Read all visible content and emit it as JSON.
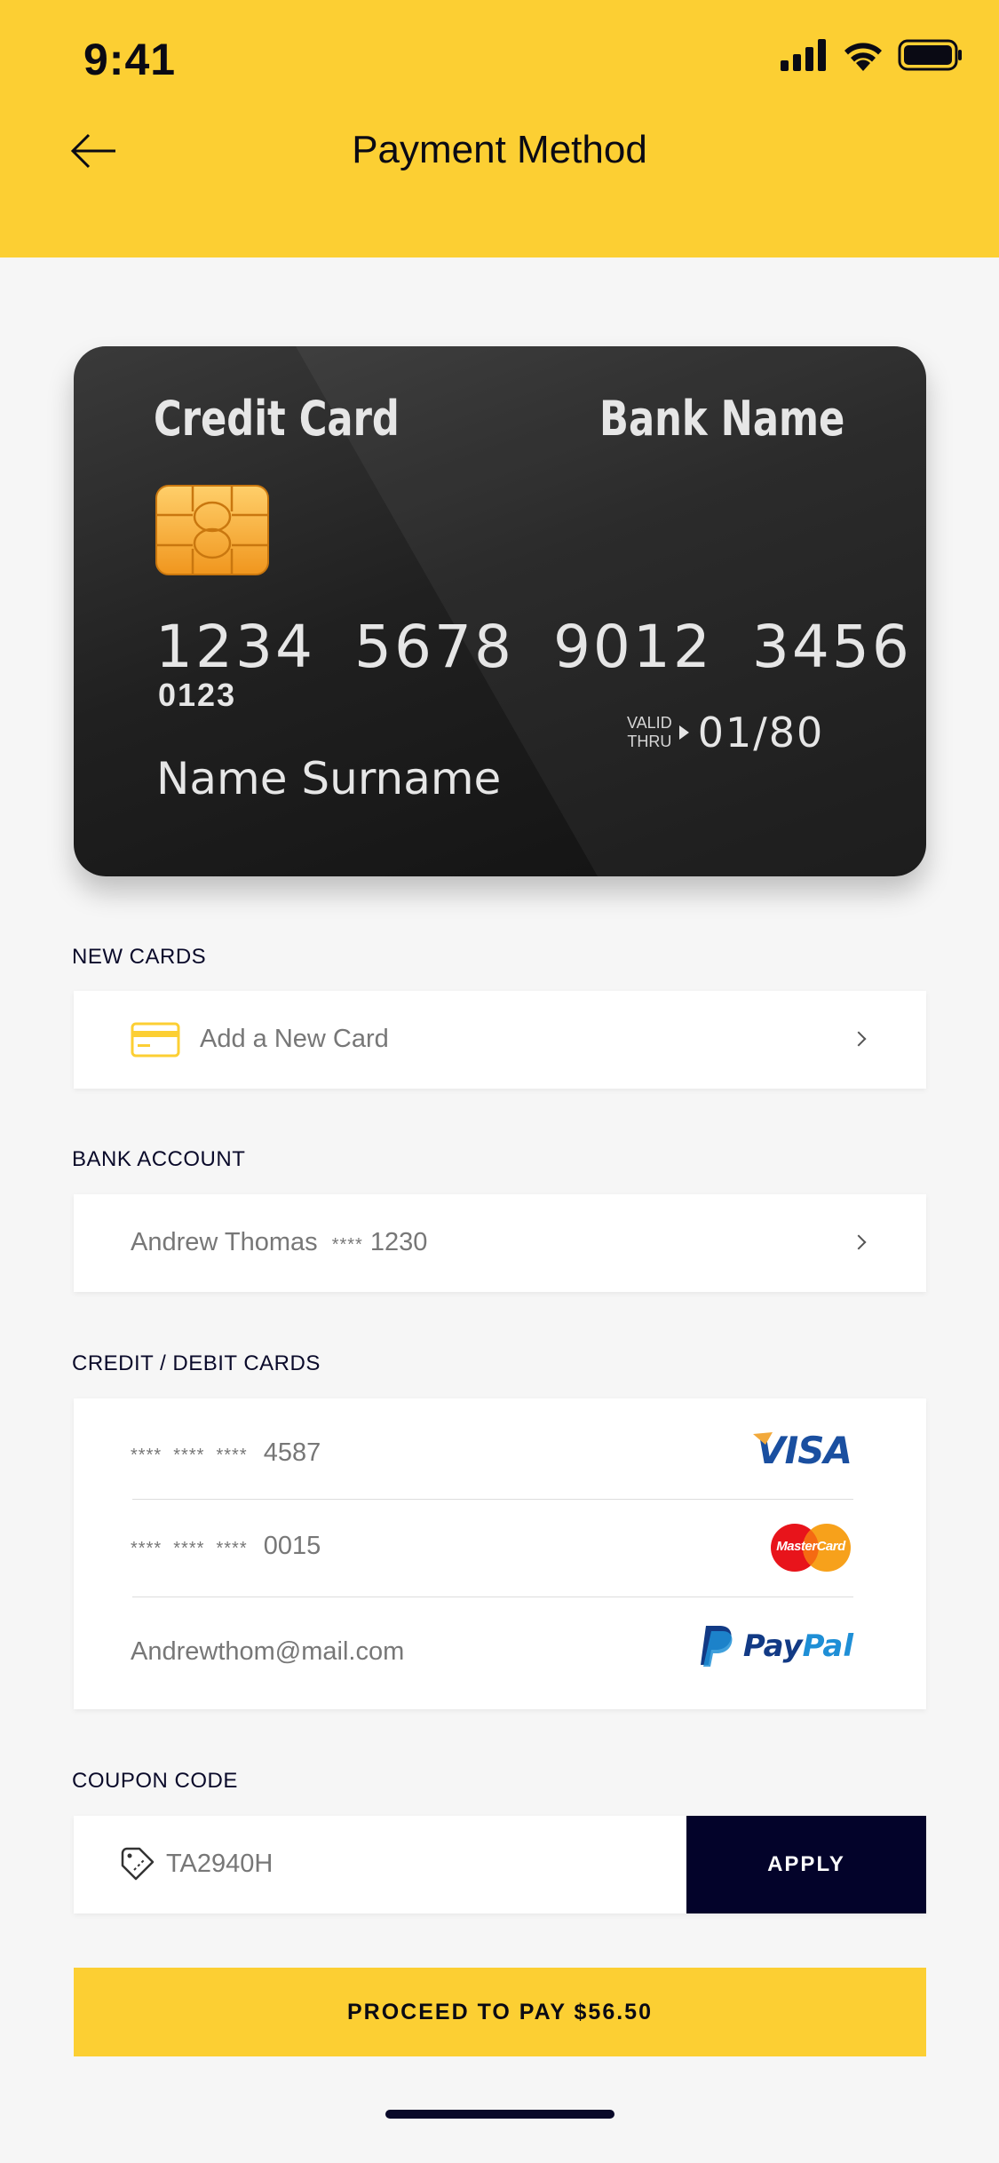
{
  "status_bar": {
    "time": "9:41"
  },
  "header": {
    "title": "Payment Method"
  },
  "card": {
    "type": "Credit Card",
    "bank": "Bank Name",
    "number_groups": [
      "1234",
      "5678",
      "9012",
      "3456"
    ],
    "code": "0123",
    "valid_label_1": "VALID",
    "valid_label_2": "THRU",
    "valid_date": "01/80",
    "holder": "Name Surname"
  },
  "new_cards": {
    "label": "NEW CARDS",
    "add_label": "Add a New Card"
  },
  "bank_account": {
    "label": "BANK ACCOUNT",
    "name": "Andrew Thomas",
    "masked": "****",
    "last4": "1230"
  },
  "cards": {
    "label": "CREDIT / DEBIT CARDS",
    "items": [
      {
        "masked": "****  ****  ****",
        "last4": "4587",
        "brand": "VISA"
      },
      {
        "masked": "****  ****  ****",
        "last4": "0015",
        "brand": "MasterCard"
      },
      {
        "email": "Andrewthom@mail.com",
        "brand_prefix": "Pay",
        "brand_suffix": "Pal"
      }
    ]
  },
  "coupon": {
    "label": "COUPON CODE",
    "value": "TA2940H",
    "apply_label": "APPLY"
  },
  "proceed": {
    "label": "PROCEED TO PAY $56.50"
  },
  "colors": {
    "accent": "#fccf33",
    "dark": "#03032a",
    "card_bg": "#202020"
  }
}
